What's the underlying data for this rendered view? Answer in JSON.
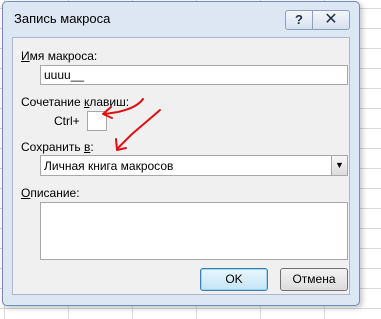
{
  "dialog": {
    "title": "Запись макроса",
    "help_glyph": "?",
    "close_glyph": "✕"
  },
  "form": {
    "macro_name": {
      "label_underlined": "И",
      "label_rest": "мя макроса:",
      "value": "uuuu__"
    },
    "shortcut": {
      "label_start": "Сочетание ",
      "label_underlined": "к",
      "label_end": "лавиш:",
      "prefix": "Ctrl+",
      "value": ""
    },
    "store_in": {
      "label_start": "Сохранить ",
      "label_underlined": "в",
      "label_end": ":",
      "selected": "Личная книга макросов"
    },
    "description": {
      "label_underlined": "О",
      "label_rest": "писание:",
      "value": ""
    }
  },
  "buttons": {
    "ok": "OK",
    "cancel": "Отмена"
  },
  "colors": {
    "annotation_red": "#e01010",
    "frame_blue": "#dde7f4"
  }
}
